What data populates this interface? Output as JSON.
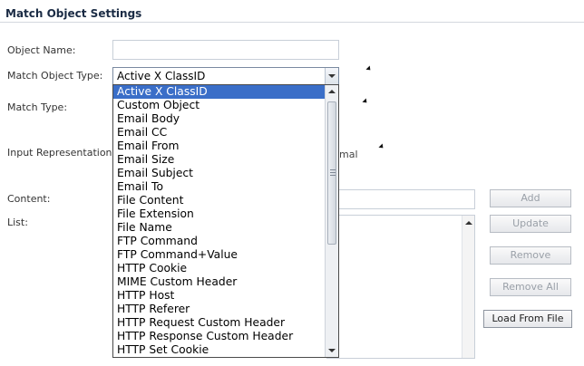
{
  "panel": {
    "title": "Match Object Settings"
  },
  "fields": {
    "object_name_label": "Object Name:",
    "object_name_value": "",
    "match_object_type_label": "Match Object Type:",
    "match_object_type_value": "Active X ClassID",
    "match_type_label": "Match Type:",
    "input_representation_label": "Input Representation:",
    "input_representation_partial": "mal",
    "content_label": "Content:",
    "content_value": "",
    "list_label": "List:"
  },
  "buttons": {
    "add": "Add",
    "update": "Update",
    "remove": "Remove",
    "remove_all": "Remove All",
    "load_from_file": "Load From File"
  },
  "dropdown": {
    "selected_index": 0,
    "options": [
      "Active X ClassID",
      "Custom Object",
      "Email Body",
      "Email CC",
      "Email From",
      "Email Size",
      "Email Subject",
      "Email To",
      "File Content",
      "File Extension",
      "File Name",
      "FTP Command",
      "FTP Command+Value",
      "HTTP Cookie",
      "MIME Custom Header",
      "HTTP Host",
      "HTTP Referer",
      "HTTP Request Custom Header",
      "HTTP Response Custom Header",
      "HTTP Set Cookie"
    ]
  },
  "colors": {
    "selection": "#3a6ec8",
    "title": "#1a2b44"
  }
}
